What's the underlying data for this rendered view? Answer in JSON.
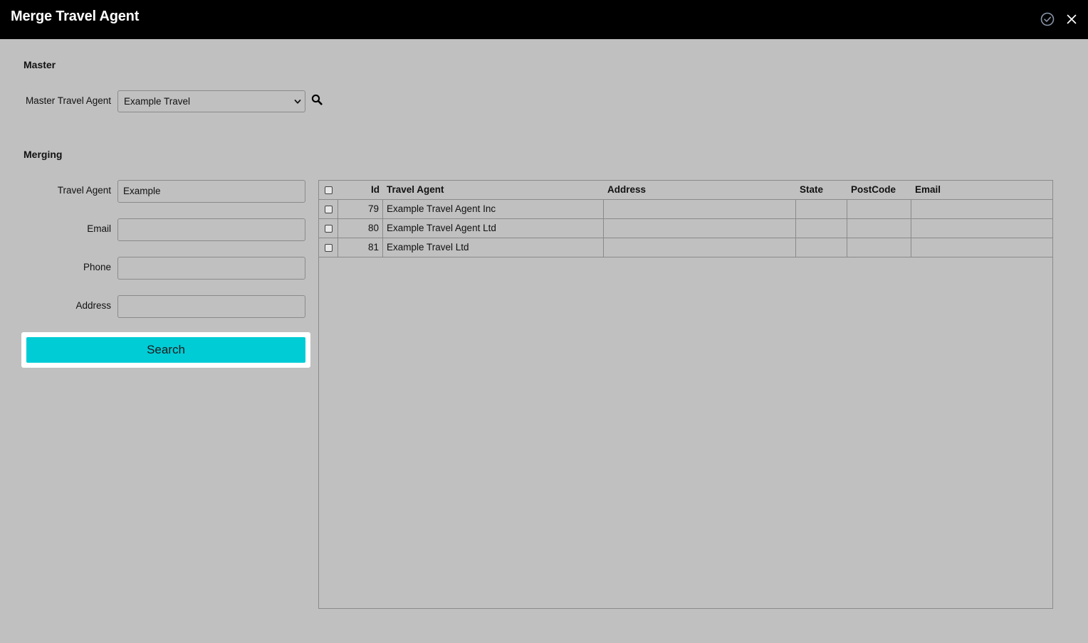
{
  "window": {
    "title": "Merge Travel Agent"
  },
  "master": {
    "heading": "Master",
    "agent_label": "Master Travel Agent",
    "agent_selected": "Example Travel"
  },
  "merging": {
    "heading": "Merging",
    "fields": {
      "travel_agent": {
        "label": "Travel Agent",
        "value": "Example"
      },
      "email": {
        "label": "Email",
        "value": ""
      },
      "phone": {
        "label": "Phone",
        "value": ""
      },
      "address": {
        "label": "Address",
        "value": ""
      }
    },
    "search_label": "Search"
  },
  "table": {
    "columns": [
      "Id",
      "Travel Agent",
      "Address",
      "State",
      "PostCode",
      "Email"
    ],
    "rows": [
      {
        "id": "79",
        "agent": "Example Travel Agent Inc",
        "address": "",
        "state": "",
        "postcode": "",
        "email": ""
      },
      {
        "id": "80",
        "agent": "Example Travel Agent Ltd",
        "address": "",
        "state": "",
        "postcode": "",
        "email": ""
      },
      {
        "id": "81",
        "agent": "Example Travel Ltd",
        "address": "",
        "state": "",
        "postcode": "",
        "email": ""
      }
    ]
  },
  "colors": {
    "accent": "#00ccd6",
    "titlebar": "#000000",
    "background": "#c0c0c0"
  },
  "icons": {
    "confirm": "check-circle-icon",
    "close": "close-icon",
    "lookup": "search-icon",
    "dropdown": "chevron-down-icon"
  }
}
